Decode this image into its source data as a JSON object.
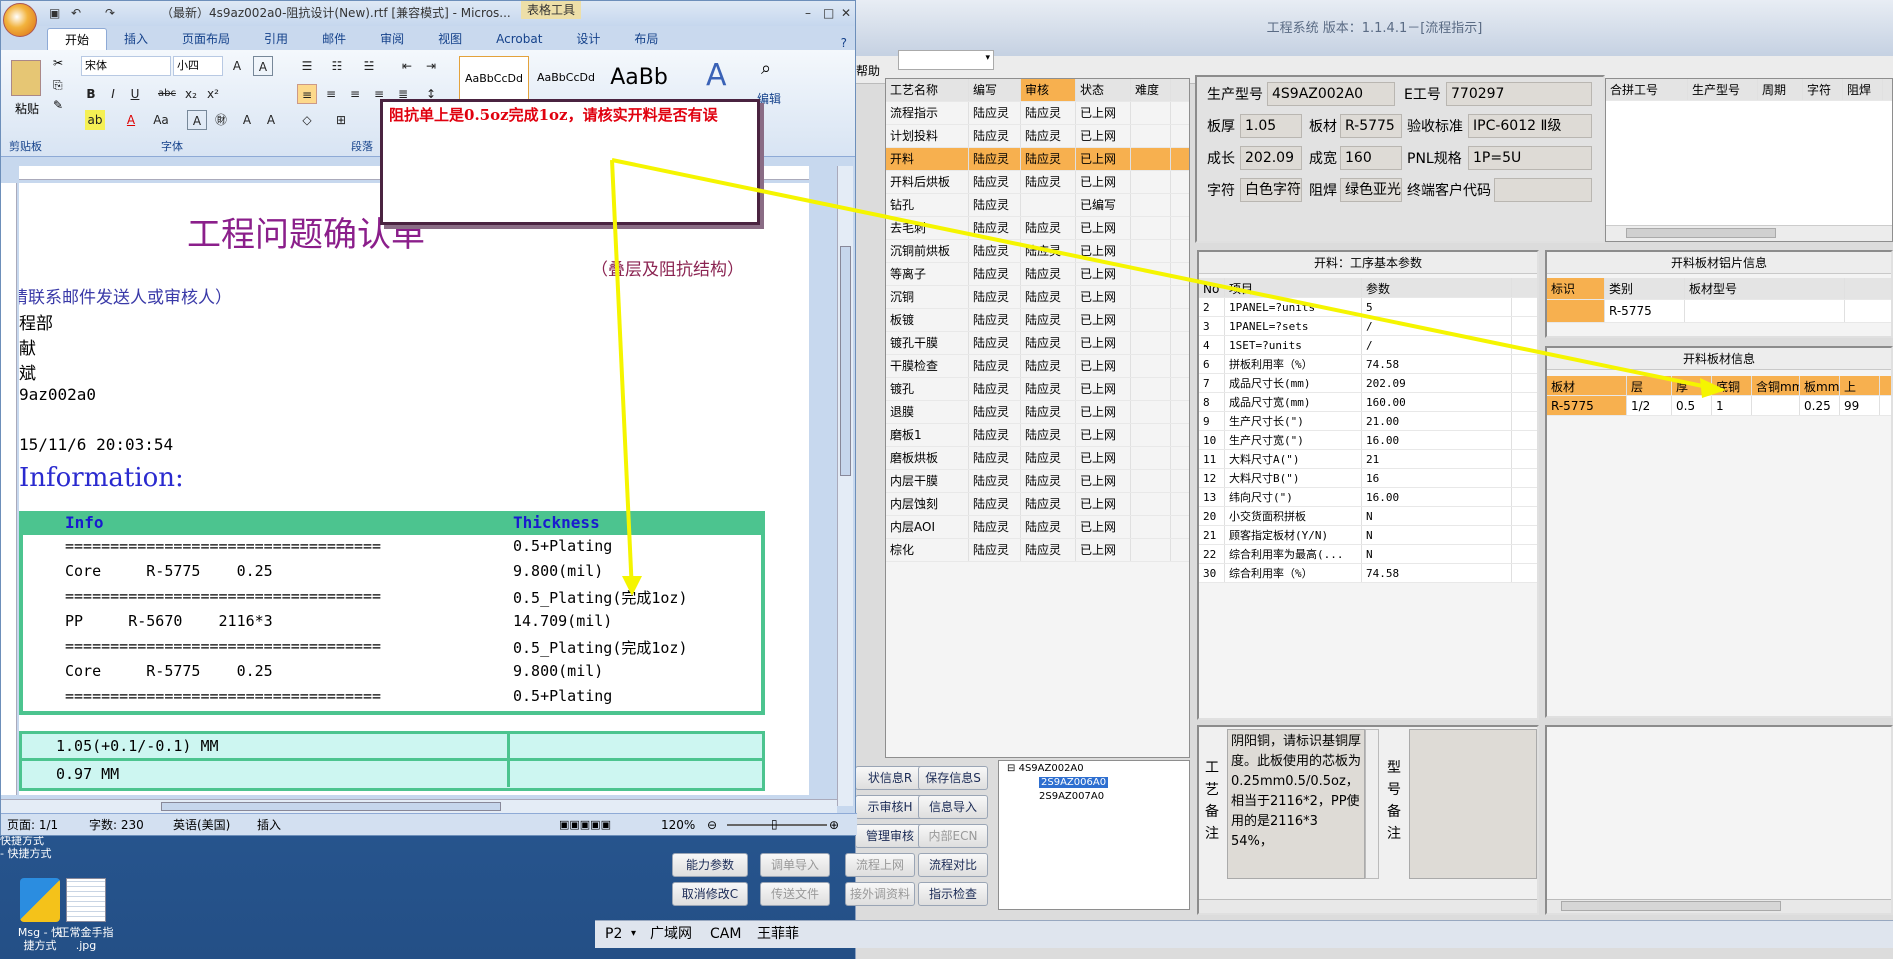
{
  "desktop": {
    "icons": [
      {
        "label": "Msg - 快捷方式",
        "line1": "Msg - 快",
        "line2": "捷方式"
      },
      {
        "label": "正常金手指 .jpg",
        "line1": "正常金手指",
        "line2": ".jpg"
      }
    ],
    "partial_labels": [
      "快捷方式",
      "- 快捷方式"
    ]
  },
  "erp": {
    "title": "工程系统 版本：1.1.4.1－[流程指示]",
    "menu_help": "帮助",
    "info": {
      "production_no_label": "生产型号",
      "production_no": "4S9AZ002A0",
      "e_no_label": "E工号",
      "e_no": "770297",
      "thickness_label": "板厚",
      "thickness": "1.05",
      "material_label": "板材",
      "material": "R-5775",
      "standard_label": "验收标准",
      "standard": "IPC-6012 Ⅱ级",
      "length_label": "成长",
      "length": "202.09",
      "width_label": "成宽",
      "width": "160",
      "pnl_label": "PNL规格",
      "pnl": "1P=5U",
      "char_label": "字符",
      "char": "白色字符",
      "mask_label": "阻焊",
      "mask": "绿色亚光",
      "customer_label": "终端客户代码",
      "customer": ""
    },
    "combined_headers": [
      "合拼工号",
      "生产型号",
      "周期",
      "字符",
      "阻焊"
    ],
    "process_headers": [
      "工艺名称",
      "编写",
      "审核",
      "状态",
      "难度"
    ],
    "process_rows": [
      [
        "流程指示",
        "陆应灵",
        "陆应灵",
        "已上网"
      ],
      [
        "计划投料",
        "陆应灵",
        "陆应灵",
        "已上网"
      ],
      [
        "开料",
        "陆应灵",
        "陆应灵",
        "已上网"
      ],
      [
        "开料后烘板",
        "陆应灵",
        "陆应灵",
        "已上网"
      ],
      [
        "钻孔",
        "陆应灵",
        "",
        "已编写"
      ],
      [
        "去毛刺",
        "陆应灵",
        "陆应灵",
        "已上网"
      ],
      [
        "沉铜前烘板",
        "陆应灵",
        "陆应灵",
        "已上网"
      ],
      [
        "等离子",
        "陆应灵",
        "陆应灵",
        "已上网"
      ],
      [
        "沉铜",
        "陆应灵",
        "陆应灵",
        "已上网"
      ],
      [
        "板镀",
        "陆应灵",
        "陆应灵",
        "已上网"
      ],
      [
        "镀孔干膜",
        "陆应灵",
        "陆应灵",
        "已上网"
      ],
      [
        "干膜检查",
        "陆应灵",
        "陆应灵",
        "已上网"
      ],
      [
        "镀孔",
        "陆应灵",
        "陆应灵",
        "已上网"
      ],
      [
        "退膜",
        "陆应灵",
        "陆应灵",
        "已上网"
      ],
      [
        "磨板1",
        "陆应灵",
        "陆应灵",
        "已上网"
      ],
      [
        "磨板烘板",
        "陆应灵",
        "陆应灵",
        "已上网"
      ],
      [
        "内层干膜",
        "陆应灵",
        "陆应灵",
        "已上网"
      ],
      [
        "内层蚀刻",
        "陆应灵",
        "陆应灵",
        "已上网"
      ],
      [
        "内层AOI",
        "陆应灵",
        "陆应灵",
        "已上网"
      ],
      [
        "棕化",
        "陆应灵",
        "陆应灵",
        "已上网"
      ]
    ],
    "params_title": "开料：工序基本参数",
    "params_headers": [
      "No",
      "项目",
      "参数"
    ],
    "params_rows": [
      [
        "2",
        "1PANEL=?units",
        "5"
      ],
      [
        "3",
        "1PANEL=?sets",
        "/"
      ],
      [
        "4",
        "1SET=?units",
        "/"
      ],
      [
        "6",
        "拼板利用率（%）",
        "74.58"
      ],
      [
        "7",
        "成品尺寸长(mm)",
        "202.09"
      ],
      [
        "8",
        "成品尺寸宽(mm)",
        "160.00"
      ],
      [
        "9",
        "生产尺寸长(\")",
        "21.00"
      ],
      [
        "10",
        "生产尺寸宽(\")",
        "16.00"
      ],
      [
        "11",
        "大料尺寸A(\")",
        "21"
      ],
      [
        "12",
        "大料尺寸B(\")",
        "16"
      ],
      [
        "13",
        "纬向尺寸(\")",
        "16.00"
      ],
      [
        "20",
        "小交货面积拼板",
        "N"
      ],
      [
        "21",
        "顾客指定板材(Y/N)",
        "N"
      ],
      [
        "22",
        "综合利用率为最高(...",
        "N"
      ],
      [
        "30",
        "综合利用率（%）",
        "74.58"
      ]
    ],
    "alu_title": "开料板材铝片信息",
    "alu_headers": [
      "标识",
      "类别",
      "板材型号"
    ],
    "alu_row": [
      "",
      "R-5775",
      ""
    ],
    "board_title": "开料板材信息",
    "board_headers": [
      "板材",
      "层",
      "厚",
      "底铜",
      "含铜mm",
      "板mm",
      "上"
    ],
    "board_row": [
      "R-5775",
      "1/2",
      "0.5",
      "1",
      "",
      "0.25",
      "99"
    ],
    "buttons": [
      {
        "label": "状信息R",
        "disabled": false
      },
      {
        "label": "保存信息S",
        "disabled": false
      },
      {
        "label": "示审核H",
        "disabled": false
      },
      {
        "label": "信息导入",
        "disabled": false
      },
      {
        "label": "管理审核",
        "disabled": false
      },
      {
        "label": "内部ECN",
        "disabled": true
      },
      {
        "label": "能力参数",
        "disabled": false
      },
      {
        "label": "调单导入",
        "disabled": true
      },
      {
        "label": "流程上网",
        "disabled": true
      },
      {
        "label": "流程对比",
        "disabled": false
      },
      {
        "label": "取消修改C",
        "disabled": false
      },
      {
        "label": "传送文件",
        "disabled": true
      },
      {
        "label": "接外调资料",
        "disabled": true
      },
      {
        "label": "指示检查",
        "disabled": false
      }
    ],
    "tree": [
      "4S9AZ002A0",
      "2S9AZ006A0",
      "2S9AZ007A0"
    ],
    "note_label": "工艺备注",
    "note_text": "阴阳铜，请标识基铜厚度。此板使用的芯板为0.25mm0.5/0.5oz，相当于2116*2，PP使用的是2116*3 54%，",
    "type_note_label": "型号备注",
    "status_bar": [
      "P2",
      "广域网",
      "CAM",
      "王菲菲"
    ]
  },
  "word": {
    "title": "（最新）4s9az002a0-阻抗设计(New).rtf [兼容模式] - Micros...",
    "contextual_tab": "表格工具",
    "tabs": [
      "开始",
      "插入",
      "页面布局",
      "引用",
      "邮件",
      "审阅",
      "视图",
      "Acrobat",
      "设计",
      "布局"
    ],
    "font_name": "宋体",
    "font_size": "小四",
    "styles": [
      "AaBbCcDd",
      "AaBbCcDd",
      "AaBb"
    ],
    "groups": [
      "剪贴板",
      "字体",
      "段落",
      "编辑"
    ],
    "paste": "粘贴",
    "doc_title": "工程问题确认单",
    "subtitle": "（叠层及阻抗结构）",
    "contact": "请联系邮件发送人或审核人）",
    "lines": [
      "程部",
      "献",
      "斌",
      "9az002a0",
      "15/11/6 20:03:54"
    ],
    "info_heading": "Information:",
    "stack_headers": [
      "Info",
      "Thickness"
    ],
    "stack_rows": [
      [
        "===================================",
        "0.5+Plating"
      ],
      [
        "Core     R-5775    0.25",
        "9.800(mil)"
      ],
      [
        "===================================",
        "0.5_Plating(完成1oz)"
      ],
      [
        "PP     R-5670    2116*3",
        "14.709(mil)"
      ],
      [
        "===================================",
        "0.5_Plating(完成1oz)"
      ],
      [
        "Core     R-5775    0.25",
        "9.800(mil)"
      ],
      [
        "===================================",
        "0.5+Plating"
      ]
    ],
    "thick_rows": [
      "1.05(+0.1/-0.1) MM",
      "0.97 MM"
    ],
    "status": {
      "page": "页面: 1/1",
      "words": "字数: 230",
      "lang": "英语(美国)",
      "mode": "插入",
      "zoom": "120%"
    },
    "callout": "阻抗单上是0.5oz完成1oz，请核实开料是否有误"
  },
  "colors": {
    "highlight": "#f7b04f",
    "teal": "#4cc48f",
    "purple_title": "#8b1f8b",
    "callout_red": "#e0000e",
    "arrow": "#f5f500"
  }
}
